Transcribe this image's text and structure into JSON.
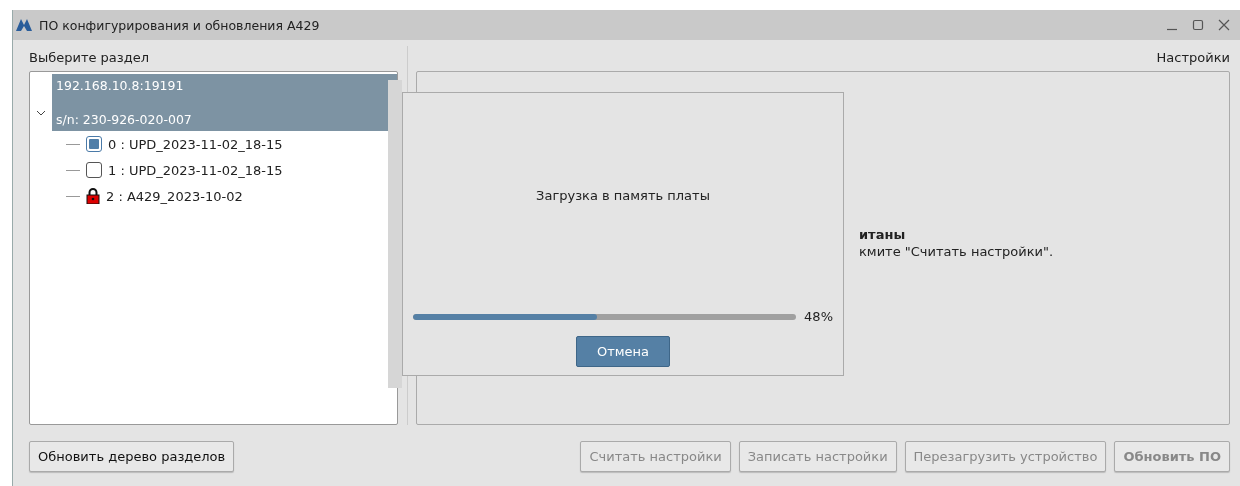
{
  "window": {
    "title": "ПО конфигурирования и обновления А429"
  },
  "left_panel": {
    "label": "Выберите раздел",
    "tree": [
      {
        "kind": "device",
        "lines": [
          "192.168.10.8:19191",
          "s/n: 230-926-020-007"
        ],
        "selected": true,
        "expanded": true,
        "children": [
          {
            "kind": "checkbox",
            "label": "0 : UPD_2023-11-02_18-15",
            "checked": true
          },
          {
            "kind": "checkbox",
            "label": "1 : UPD_2023-11-02_18-15",
            "checked": false
          },
          {
            "kind": "locked",
            "label": "2 : A429_2023-10-02"
          }
        ]
      }
    ],
    "button": "Обновить дерево разделов"
  },
  "right_panel": {
    "label": "Настройки",
    "message_title": "итаны",
    "message_text": "кмите \"Считать настройки\"."
  },
  "dialog": {
    "text": "Загрузка в память платы",
    "progress": {
      "level": 0.48,
      "reading": "48%"
    },
    "button": "Отмена"
  },
  "buttons": [
    {
      "label": "Считать настройки",
      "disabled": true,
      "default": false
    },
    {
      "label": "Записать настройки",
      "disabled": true,
      "default": false
    },
    {
      "label": "Перезагрузить устройство",
      "disabled": true,
      "default": false
    },
    {
      "label": "Обновить ПО",
      "disabled": true,
      "default": true
    }
  ]
}
